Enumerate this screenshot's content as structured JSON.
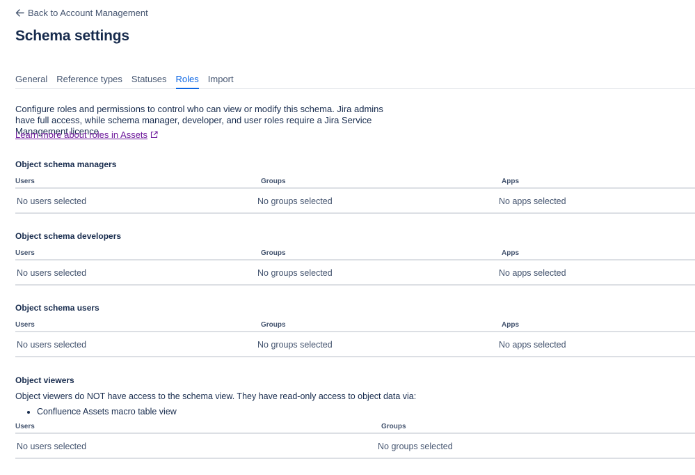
{
  "back_link": {
    "label": "Back to Account Management"
  },
  "page_title": "Schema settings",
  "tabs": [
    {
      "label": "General"
    },
    {
      "label": "Reference types"
    },
    {
      "label": "Statuses"
    },
    {
      "label": "Roles"
    },
    {
      "label": "Import"
    }
  ],
  "active_tab": "Roles",
  "description": "Configure roles and permissions to control who can view or modify this schema. Jira admins have full access, while schema manager, developer, and user roles require a Jira Service Management licence.",
  "learn_more": {
    "label": "Learn more about roles in Assets",
    "icon": "external-link-icon"
  },
  "columns": {
    "users": "Users",
    "groups": "Groups",
    "apps": "Apps"
  },
  "empty": {
    "users": "No users selected",
    "groups": "No groups selected",
    "apps": "No apps selected"
  },
  "sections": {
    "managers": {
      "title": "Object schema managers"
    },
    "developers": {
      "title": "Object schema developers"
    },
    "users": {
      "title": "Object schema users"
    },
    "viewers": {
      "title": "Object viewers",
      "text": "Object viewers do NOT have access to the schema view. They have read-only access to object data via:",
      "list": [
        "Confluence Assets macro table view"
      ]
    }
  },
  "colors": {
    "accent": "#0c66e4",
    "link_visited": "#6e1a9c",
    "border": "#dcdfe4"
  }
}
